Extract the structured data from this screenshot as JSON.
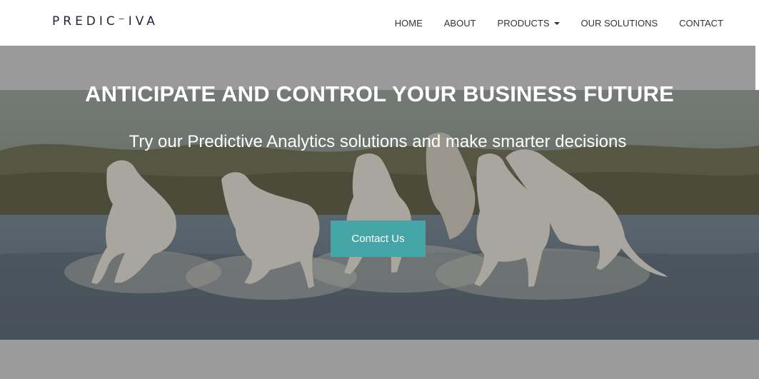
{
  "navbar": {
    "logo_text": "PREDIC⁻IVA",
    "items": [
      {
        "label": "HOME"
      },
      {
        "label": "ABOUT"
      },
      {
        "label": "PRODUCTS",
        "has_dropdown": true
      },
      {
        "label": "OUR SOLUTIONS"
      },
      {
        "label": "CONTACT"
      }
    ]
  },
  "hero": {
    "title": "ANTICIPATE AND CONTROL YOUR BUSINESS FUTURE",
    "subtitle": "Try our Predictive Analytics solutions and make smarter decisions",
    "cta_label": "Contact Us",
    "background_image": "white horses running through water"
  },
  "colors": {
    "accent": "#46a5a7",
    "nav_text": "#333333",
    "logo": "#20263a",
    "overlay_gray": "#9b9b9b"
  }
}
